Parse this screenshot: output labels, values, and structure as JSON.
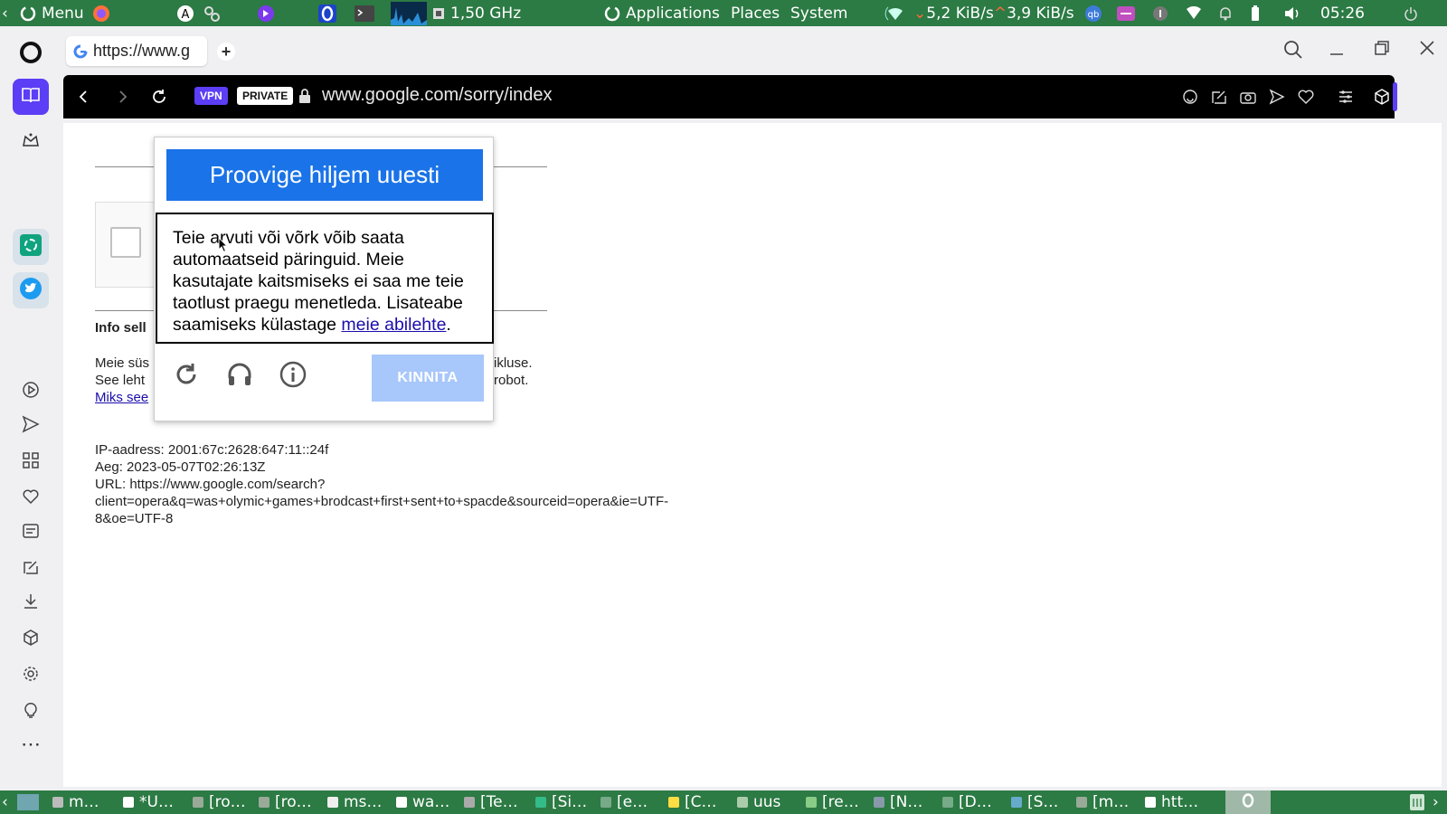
{
  "top_panel": {
    "menu_label": "Menu",
    "cpu_freq": "1,50 GHz",
    "applications": "Applications",
    "places": "Places",
    "system": "System",
    "net_down": "5,2 KiB/s",
    "net_up": "3,9 KiB/s",
    "clock": "05:26"
  },
  "browser": {
    "tab_title": "https://www.g",
    "vpn_badge": "VPN",
    "private_badge": "PRIVATE",
    "url": "www.google.com/sorry/index"
  },
  "page": {
    "info_heading": "Info sell",
    "line1_left": "Meie süs",
    "line1_right": "ikluse.",
    "line2_left": "See leht",
    "line2_right": "robot.",
    "link_left": "Miks see",
    "ip": "IP-aadress: 2001:67c:2628:647:11::24f",
    "time": "Aeg: 2023-05-07T02:26:13Z",
    "url_line1": "URL: https://www.google.com/search?",
    "url_line2": "client=opera&q=was+olymic+games+brodcast+first+sent+to+spacde&sourceid=opera&ie=UTF-",
    "url_line3": "8&oe=UTF-8"
  },
  "captcha": {
    "header": "Proovige hiljem uuesti",
    "message": "Teie arvuti või võrk võib saata automaatseid päringuid. Meie kasutajate kaitsmiseks ei saa me teie taotlust praegu menetleda. Lisateabe saamiseks külastage ",
    "help_link": "meie abilehte",
    "message_end": ".",
    "verify_button": "KINNITA"
  },
  "taskbar": {
    "items": [
      "m…",
      "*U…",
      "[ro…",
      "[ro…",
      "ms…",
      "wa…",
      "[Te…",
      "[Si…",
      "[e…",
      "[C…",
      "uus",
      "[re…",
      "[N…",
      "[D…",
      "[S…",
      "[m…",
      "htt…"
    ]
  },
  "colors": {
    "panel_green": "#2c7a44",
    "google_blue": "#1a73e8",
    "verify_disabled": "#a8c7fa",
    "opera_purple": "#5b3ef5"
  }
}
